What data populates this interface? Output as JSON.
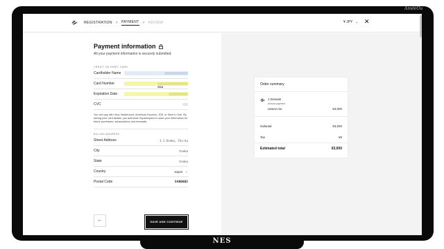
{
  "header": {
    "crumbs": [
      "REGISTRATION",
      "PAYMENT",
      "REVIEW"
    ],
    "currency": "¥ JPY"
  },
  "payment": {
    "title": "Payment information",
    "subtitle": "All your payment information is securely submitted.",
    "card_section": "CREDIT OR DEBIT CARD",
    "fields": {
      "cardholder": "Cardholder Name",
      "card_number": "Card Number",
      "card_brand": "VISA",
      "expiration": "Expiration Date",
      "cvc": "CVC"
    },
    "note": "You can pay with Visa, Mastercard, American Express, JCB, or Diner's Club. By saving your card details, you authorize Squarespace to save your information for future purchases, subscriptions and renewals.",
    "billing_section": "BILLING ADDRESS",
    "billing": {
      "street_label": "Street Address",
      "street_value": "1-1 Osaka, Chu-ku",
      "city_label": "City",
      "city_value": "Osaka",
      "state_label": "State",
      "state_value": "Osaka",
      "country_label": "Country",
      "country_value": "Japan",
      "postal_label": "Postal Code",
      "postal_value": "5400002"
    },
    "save_label": "SAVE AND CONTINUE"
  },
  "summary": {
    "title": "Order summary",
    "item_title": "1 Domain",
    "item_sub": "Annual payment",
    "domain": "newce.me",
    "domain_price": "¥3,000",
    "subtotal_label": "Subtotal",
    "subtotal_value": "¥3,000",
    "tax_label": "Tax",
    "tax_value": "¥0",
    "total_label": "Estimated total",
    "total_value": "¥3,000"
  },
  "frame": {
    "stand_label": "NES",
    "signature": "AmdeOu"
  }
}
